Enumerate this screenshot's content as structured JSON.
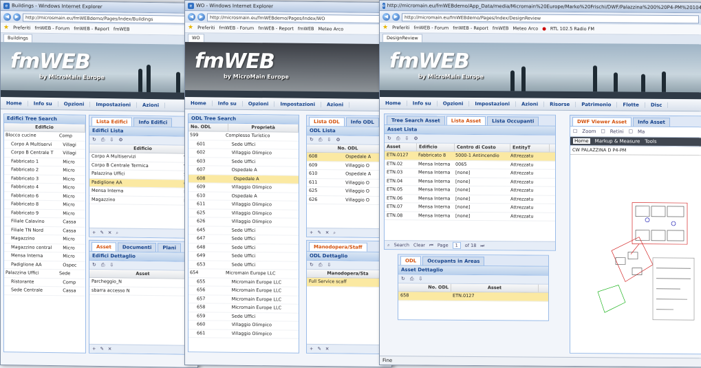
{
  "window1": {
    "title": "Buildings - Windows Internet Explorer",
    "url": "http://microsmain.eu/fmWEBdemo/Pages/Index/Buildings",
    "favorites_label": "Preferiti",
    "fav_links": [
      "fmWEB - Forum",
      "fmWEB - Report",
      "fmWEB"
    ],
    "tab_title": "Buildings",
    "logo": "fmWEB",
    "logo_sub": "by MicroMain Europe",
    "menu": [
      "Home",
      "Info su",
      "Opzioni",
      "Impostazioni",
      "Azioni"
    ],
    "tree_panel": {
      "title": "Edifici Tree Search",
      "header": "Edificio",
      "rows": [
        {
          "name": "Blocco cucine",
          "val": "Comp"
        },
        {
          "name": "Corpo A Multiservi",
          "val": "Villagi"
        },
        {
          "name": "Corpo B Centrale T",
          "val": "Villagi"
        },
        {
          "name": "Fabbricato 1",
          "val": "Micro"
        },
        {
          "name": "Fabbricato 2",
          "val": "Micro"
        },
        {
          "name": "Fabbricato 3",
          "val": "Micro"
        },
        {
          "name": "Fabbricato 4",
          "val": "Micro"
        },
        {
          "name": "Fabbricato 6",
          "val": "Micro"
        },
        {
          "name": "Fabbricato 8",
          "val": "Micro"
        },
        {
          "name": "Fabbricato 9",
          "val": "Micro"
        },
        {
          "name": "Filiale Calavino",
          "val": "Cassa"
        },
        {
          "name": "Filiale TN Nord",
          "val": "Cassa"
        },
        {
          "name": "Magazzino",
          "val": "Micro"
        },
        {
          "name": "Magazzino central",
          "val": "Micro"
        },
        {
          "name": "Mensa Interna",
          "val": "Micro"
        },
        {
          "name": "Padiglione AA",
          "val": "Ospec"
        },
        {
          "name": "Palazzina Uffici",
          "val": "Sede"
        },
        {
          "name": "Ristorante",
          "val": "Comp"
        },
        {
          "name": "Sede Centrale",
          "val": "Cassa"
        }
      ]
    },
    "tabs_top": [
      "Lista Edifici",
      "Info Edifici"
    ],
    "list_panel": {
      "title": "Edifici Lista",
      "header": "Edificio",
      "rows": [
        "Corpo A Multiservizi",
        "Corpo B Centrale Termica",
        "Palazzina Uffici",
        "Padiglione AA",
        "Mensa Interna",
        "Magazzino"
      ],
      "row_tags": [
        "Vi",
        "Vi",
        "Se",
        "Os",
        "Mi",
        "Mi"
      ]
    },
    "tabs_bottom": [
      "Asset",
      "Documenti",
      "Plani"
    ],
    "detail_panel": {
      "title": "Edifici Dettaglio",
      "header": "Asset",
      "rows": [
        "Parcheggio_N",
        "sbarra accesso N"
      ]
    },
    "status": ""
  },
  "window2": {
    "title": "WO - Windows Internet Explorer",
    "url": "http://microsmain.eu/fmWEBdemo/Pages/Index/WO",
    "favorites_label": "Preferiti",
    "fav_links": [
      "fmWEB - Forum",
      "fmWEB - Report",
      "fmWEB",
      "Meteo Arco"
    ],
    "tab_title": "WO",
    "logo": "fmWEB",
    "logo_sub": "by MicroMain Europe",
    "menu": [
      "Home",
      "Info su",
      "Opzioni",
      "Impostazioni",
      "Azioni"
    ],
    "tree_panel": {
      "title": "ODL Tree Search",
      "col1": "No. ODL",
      "col2": "Proprietà",
      "rows": [
        {
          "num": "599",
          "prop": "Complesso Turistico",
          "top": true
        },
        {
          "num": "601",
          "prop": "Sede Uffici"
        },
        {
          "num": "602",
          "prop": "Villaggio Olimpico"
        },
        {
          "num": "603",
          "prop": "Sede Uffici"
        },
        {
          "num": "607",
          "prop": "Ospedale A"
        },
        {
          "num": "608",
          "prop": "Ospedale A",
          "sel": true
        },
        {
          "num": "609",
          "prop": "Villaggio Olimpico"
        },
        {
          "num": "610",
          "prop": "Ospedale A"
        },
        {
          "num": "611",
          "prop": "Villaggio Olimpico"
        },
        {
          "num": "625",
          "prop": "Villaggio Olimpico"
        },
        {
          "num": "626",
          "prop": "Villaggio Olimpico"
        },
        {
          "num": "645",
          "prop": "Sede Uffici"
        },
        {
          "num": "647",
          "prop": "Sede Uffici"
        },
        {
          "num": "648",
          "prop": "Sede Uffici"
        },
        {
          "num": "649",
          "prop": "Sede Uffici"
        },
        {
          "num": "653",
          "prop": "Sede Uffici"
        },
        {
          "num": "654",
          "prop": "Micromain Europe LLC",
          "top": true
        },
        {
          "num": "655",
          "prop": "Micromain Europe LLC"
        },
        {
          "num": "656",
          "prop": "Micromain Europe LLC"
        },
        {
          "num": "657",
          "prop": "Micromain Europe LLC"
        },
        {
          "num": "658",
          "prop": "Micromain Europe LLC"
        },
        {
          "num": "659",
          "prop": "Sede Uffici"
        },
        {
          "num": "660",
          "prop": "Villaggio Olimpico"
        },
        {
          "num": "661",
          "prop": "Villaggio Olimpico"
        }
      ]
    },
    "tabs_top": [
      "Lista ODL",
      "Info ODL"
    ],
    "list_panel": {
      "title": "ODL Lista",
      "header": "No. ODL",
      "rows": [
        {
          "num": "608",
          "prop": "Ospedale A",
          "sel": true
        },
        {
          "num": "609",
          "prop": "Villaggio O"
        },
        {
          "num": "610",
          "prop": "Ospedale A"
        },
        {
          "num": "611",
          "prop": "Villaggio O"
        },
        {
          "num": "625",
          "prop": "Villaggio O"
        },
        {
          "num": "626",
          "prop": "Villaggio O"
        }
      ]
    },
    "tabs_bottom": [
      "Manodopera/Staff"
    ],
    "detail_panel": {
      "title": "ODL Dettaglio",
      "header": "Manodopera/Sta",
      "rows": [
        "Full Service scaff"
      ]
    }
  },
  "window3": {
    "title": "http://micromain.eu/fmWEBdemo/App_Data/media/Micromain%20Europe/Marko%20Frischi/DWF/Palazzina%200%20P4-PM%20104.DWF",
    "url": "http://micromain.eu/fmWEBdemo/Pages/Index/DesignReview",
    "favorites_label": "Preferiti",
    "fav_links": [
      "fmWEB - Forum",
      "fmWEB - Report",
      "fmWEB",
      "Meteo Arco",
      "RTL 102.5 Radio FM"
    ],
    "tab_title": "DesignReview",
    "logo": "fmWEB",
    "logo_sub": "by MicroMain Europe",
    "menu": [
      "Home",
      "Info su",
      "Opzioni",
      "Impostazioni",
      "Azioni",
      "Risorse",
      "Patrimonio",
      "Flotte",
      "Disc"
    ],
    "tabs_top": [
      "Tree Search Asset",
      "Lista Asset",
      "Lista Occupanti"
    ],
    "list_panel": {
      "title": "Asset Lista",
      "headers": [
        "Asset",
        "Edificio",
        "Centro di Costo",
        "EntityT"
      ],
      "rows": [
        {
          "asset": "ETN.0127",
          "edificio": "Fabbricato 8",
          "cc": "5000-1 Antincendio",
          "et": "Attrezzatu",
          "sel": true
        },
        {
          "asset": "ETN.02",
          "edificio": "Mensa Interna",
          "cc": "0065",
          "et": "Attrezzatu"
        },
        {
          "asset": "ETN.03",
          "edificio": "Mensa Interna",
          "cc": "[none]",
          "et": "Attrezzatu"
        },
        {
          "asset": "ETN.04",
          "edificio": "Mensa Interna",
          "cc": "[none]",
          "et": "Attrezzatu"
        },
        {
          "asset": "ETN.05",
          "edificio": "Mensa Interna",
          "cc": "[none]",
          "et": "Attrezzatu"
        },
        {
          "asset": "ETN.06",
          "edificio": "Mensa Interna",
          "cc": "[none]",
          "et": "Attrezzatu"
        },
        {
          "asset": "ETN.07",
          "edificio": "Mensa Interna",
          "cc": "[none]",
          "et": "Attrezzatu"
        },
        {
          "asset": "ETN.08",
          "edificio": "Mensa Interna",
          "cc": "[none]",
          "et": "Attrezzatu"
        }
      ],
      "pager_search": "Search",
      "pager_clear": "Clear",
      "pager_page_label": "Page",
      "pager_page": "1",
      "pager_of": "of 18"
    },
    "tabs_bottom": [
      "ODL",
      "Occupants in Areas"
    ],
    "detail_panel": {
      "title": "Asset Dettaglio",
      "col1": "No. ODL",
      "col2": "Asset",
      "rows": [
        {
          "num": "658",
          "asset": "ETN.0127"
        }
      ]
    },
    "viewer_tabs": [
      "DWF Viewer Asset",
      "Info Asset"
    ],
    "viewer": {
      "zoom_label": "Zoom",
      "retini_label": "Retini",
      "ma_label": "Ma",
      "ribbon_tabs": [
        "Home",
        "Markup & Measure",
        "Tools"
      ],
      "drawing_title": "CW PALAZZINA D P4-PM"
    },
    "status": "Fine"
  }
}
